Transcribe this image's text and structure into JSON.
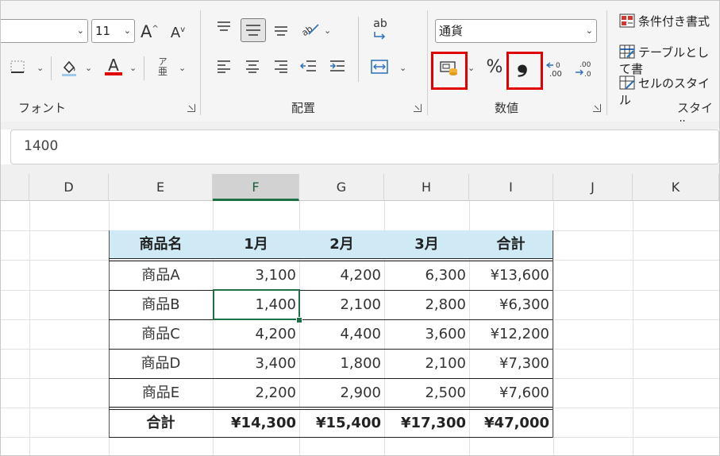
{
  "ribbon": {
    "font_size": "11",
    "font_size_up": "A",
    "font_size_down": "A",
    "font_color_letter": "A",
    "phonetic_letter": "ア",
    "phonetic_sub": "亜",
    "wrap_text_label": "ab",
    "percent_label": "%",
    "comma_label": "❟",
    "decimal_increase_label": ".00",
    "decimal_decrease_label": ".00",
    "number_format": "通貨",
    "group_font": "フォント",
    "group_alignment": "配置",
    "group_number": "数値",
    "group_styles": "スタイル",
    "conditional_format": "条件付き書式",
    "format_as_table": "テーブルとして書",
    "cell_styles": "セルのスタイル"
  },
  "formula_bar": {
    "value": "1400"
  },
  "columns": [
    "D",
    "E",
    "F",
    "G",
    "H",
    "I",
    "J",
    "K"
  ],
  "selected_column": "F",
  "table": {
    "headers": [
      "商品名",
      "1月",
      "2月",
      "3月",
      "合計"
    ],
    "rows": [
      [
        "商品A",
        "3,100",
        "4,200",
        "6,300",
        "¥13,600"
      ],
      [
        "商品B",
        "1,400",
        "2,100",
        "2,800",
        "¥6,300"
      ],
      [
        "商品C",
        "4,200",
        "4,400",
        "3,600",
        "¥12,200"
      ],
      [
        "商品D",
        "3,400",
        "1,800",
        "2,100",
        "¥7,300"
      ],
      [
        "商品E",
        "2,200",
        "2,900",
        "2,500",
        "¥7,600"
      ]
    ],
    "total": [
      "合計",
      "¥14,300",
      "¥15,400",
      "¥17,300",
      "¥47,000"
    ]
  },
  "colors": {
    "header_fill": "#cfe9f5",
    "selection": "#1e7145",
    "highlight": "#e00000"
  }
}
